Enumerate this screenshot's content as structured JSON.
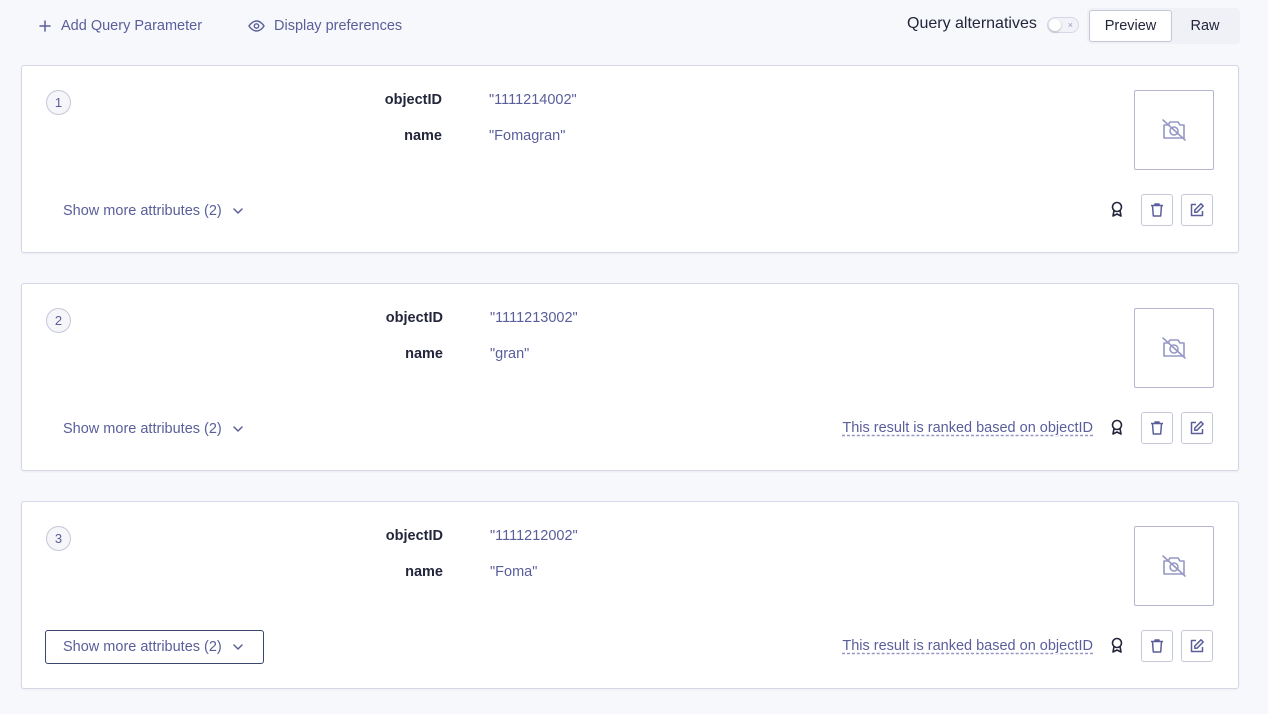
{
  "toolbar": {
    "add_param": "Add Query Parameter",
    "display_prefs": "Display preferences",
    "query_alternatives": "Query alternatives",
    "query_alternatives_enabled": false,
    "views": [
      "Preview",
      "Raw"
    ],
    "active_view": "Preview"
  },
  "hits": [
    {
      "rank": "1",
      "attributes": [
        {
          "key": "objectID",
          "value": "\"1111214002\""
        },
        {
          "key": "name",
          "value": "\"Fomagran\""
        }
      ],
      "show_more": "Show more attributes (2)",
      "ranked_note": ""
    },
    {
      "rank": "2",
      "attributes": [
        {
          "key": "objectID",
          "value": "\"1111213002\""
        },
        {
          "key": "name",
          "value": "\"gran\""
        }
      ],
      "show_more": "Show more attributes (2)",
      "ranked_note": "This result is ranked based on objectID"
    },
    {
      "rank": "3",
      "attributes": [
        {
          "key": "objectID",
          "value": "\"1111212002\""
        },
        {
          "key": "name",
          "value": "\"Foma\""
        }
      ],
      "show_more": "Show more attributes (2)",
      "ranked_note": "This result is ranked based on objectID"
    }
  ],
  "icons": {
    "add": "plus-icon",
    "display": "eye-icon",
    "image_placeholder": "no-image-camera-icon",
    "ranking": "award-icon",
    "delete": "trash-icon",
    "edit": "edit-icon",
    "expand": "chevron-down-icon"
  },
  "colors": {
    "accent": "#5a5e9a",
    "text": "#23263b",
    "border": "#d6d6e7",
    "background": "#f7f8fc"
  }
}
